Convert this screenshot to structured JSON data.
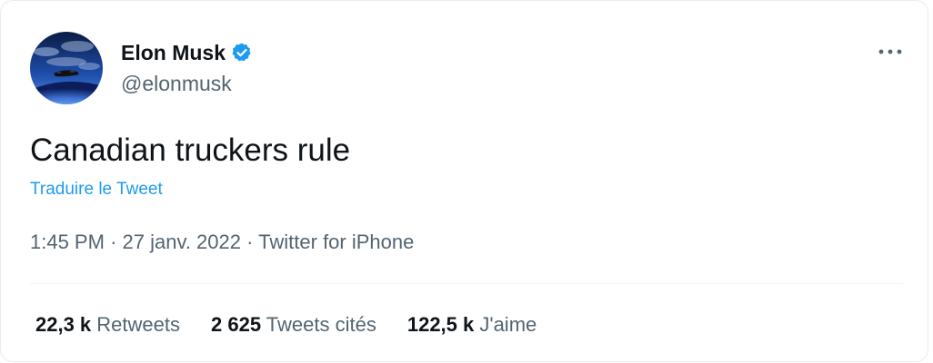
{
  "tweet": {
    "author": {
      "name": "Elon Musk",
      "handle": "@elonmusk",
      "verified": true,
      "avatar_icon": "avatar-image"
    },
    "more_icon": "more-options-icon",
    "text": "Canadian truckers rule",
    "translate_label": "Traduire le Tweet",
    "time": "1:45 PM",
    "date": "27 janv. 2022",
    "source": "Twitter for iPhone",
    "separator": "·",
    "stats": [
      {
        "value": "22,3 k",
        "label": "Retweets"
      },
      {
        "value": "2 625",
        "label": "Tweets cités"
      },
      {
        "value": "122,5 k",
        "label": "J'aime"
      }
    ]
  },
  "colors": {
    "accent": "#1d9bf0",
    "text_primary": "#0f1419",
    "text_secondary": "#536471",
    "border": "#e6ecf0"
  }
}
